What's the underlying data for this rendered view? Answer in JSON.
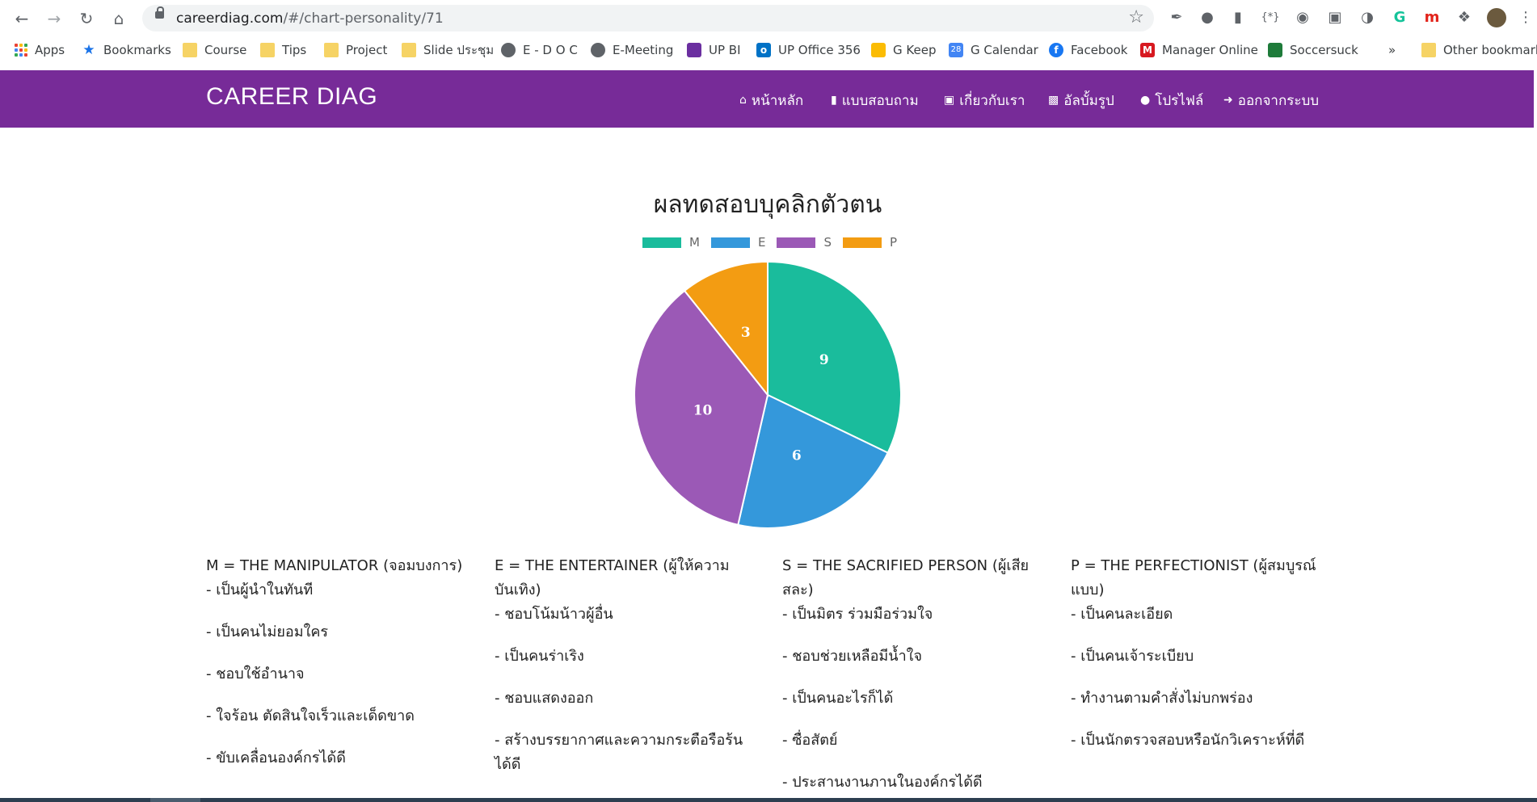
{
  "browser": {
    "url_host": "careerdiag.com",
    "url_path": "/#/chart-personality/71",
    "bookmarks": [
      {
        "label": "Apps",
        "icon": "apps-grid-icon"
      },
      {
        "label": "Bookmarks",
        "icon": "star-icon"
      },
      {
        "label": "Course",
        "icon": "folder-icon"
      },
      {
        "label": "Tips",
        "icon": "folder-icon"
      },
      {
        "label": "Project",
        "icon": "folder-icon"
      },
      {
        "label": "Slide ประชุม",
        "icon": "folder-icon"
      },
      {
        "label": "E - D O C",
        "icon": "globe-icon"
      },
      {
        "label": "E-Meeting",
        "icon": "globe-icon"
      },
      {
        "label": "UP BI",
        "icon": "up-bi-icon"
      },
      {
        "label": "UP Office 356",
        "icon": "outlook-icon"
      },
      {
        "label": "G Keep",
        "icon": "keep-icon"
      },
      {
        "label": "G Calendar",
        "icon": "calendar-icon"
      },
      {
        "label": "Facebook",
        "icon": "facebook-icon"
      },
      {
        "label": "Manager Online",
        "icon": "manager-icon"
      },
      {
        "label": "Soccersuck",
        "icon": "soccersuck-icon"
      }
    ],
    "overflow_label": "»",
    "other_bookmarks": "Other bookmarks"
  },
  "app": {
    "brand": "CAREER DIAG",
    "menu": [
      {
        "label": "หน้าหลัก",
        "icon": "home-icon"
      },
      {
        "label": "แบบสอบถาม",
        "icon": "file-icon"
      },
      {
        "label": "เกี่ยวกับเรา",
        "icon": "id-card-icon"
      },
      {
        "label": "อัลบั้มรูป",
        "icon": "photo-album-icon"
      },
      {
        "label": "โปรไฟล์",
        "icon": "user-icon"
      },
      {
        "label": "ออกจากระบบ",
        "icon": "sign-out-icon"
      }
    ]
  },
  "chart_data": {
    "type": "pie",
    "title": "ผลทดสอบบุคลิกตัวตน",
    "legend_position": "top",
    "categories": [
      "M",
      "E",
      "S",
      "P"
    ],
    "values": [
      9,
      6,
      10,
      3
    ],
    "colors": [
      "#1abc9c",
      "#3498db",
      "#9b59b6",
      "#f39c12"
    ]
  },
  "descriptions": [
    {
      "heading": "M = THE MANIPULATOR (จอมบงการ)",
      "items": [
        "- เป็นผู้นำในทันที",
        "- เป็นคนไม่ยอมใคร",
        "- ชอบใช้อำนาจ",
        "- ใจร้อน ตัดสินใจเร็วและเด็ดขาด",
        "- ขับเคลื่อนองค์กรได้ดี"
      ]
    },
    {
      "heading": "E = THE ENTERTAINER (ผู้ให้ความบันเทิง)",
      "items": [
        "- ชอบโน้มน้าวผู้อื่น",
        "- เป็นคนร่าเริง",
        "- ชอบแสดงออก",
        "- สร้างบรรยากาศและความกระตือรือร้นได้ดี"
      ]
    },
    {
      "heading": "S = THE SACRIFIED PERSON (ผู้เสียสละ)",
      "items": [
        "- เป็นมิตร ร่วมมือร่วมใจ",
        "- ชอบช่วยเหลือมีน้ำใจ",
        "- เป็นคนอะไรก็ได้",
        "- ซื่อสัตย์",
        "- ประสานงานภานในองค์กรได้ดี"
      ]
    },
    {
      "heading": "P = THE PERFECTIONIST (ผู้สมบูรณ์แบบ)",
      "items": [
        "- เป็นคนละเอียด",
        "- เป็นคนเจ้าระเบียบ",
        "- ทำงานตามคำสั่งไม่บกพร่อง",
        "- เป็นนักตรวจสอบหรือนักวิเคราะห์ที่ดี"
      ]
    }
  ]
}
